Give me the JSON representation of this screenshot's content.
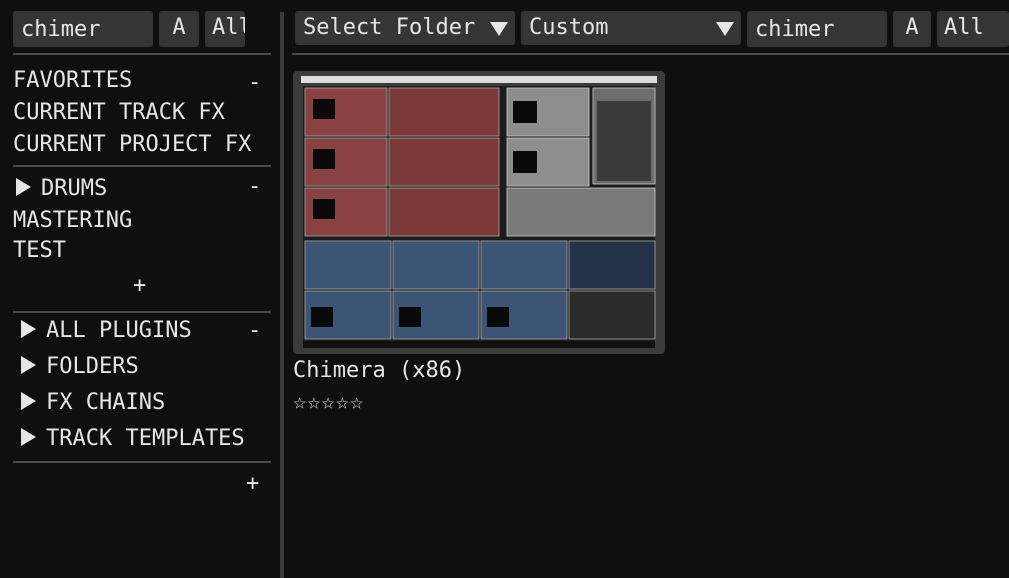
{
  "sidebar": {
    "search_value": "chimer",
    "a_button": "A",
    "all_button": "All",
    "favorites_section": {
      "items": [
        "FAVORITES",
        "CURRENT TRACK FX",
        "CURRENT PROJECT FX"
      ],
      "collapse": "-"
    },
    "custom_section": {
      "items": [
        "DRUMS",
        "MASTERING",
        "TEST"
      ],
      "collapse": "-",
      "add": "+"
    },
    "browse_section": {
      "items": [
        "ALL PLUGINS",
        "FOLDERS",
        "FX CHAINS",
        "TRACK TEMPLATES"
      ],
      "collapse": "-",
      "add": "+"
    }
  },
  "toolbar": {
    "folder_select": "Select Folder",
    "filter_select": "Custom",
    "search_value": "chimer",
    "a_button": "A",
    "all_button": "All"
  },
  "results": [
    {
      "name": "Chimera (x86)",
      "rating_display": "☆☆☆☆☆",
      "rating": 0,
      "thumbnail_icon": "plugin-screenshot-chimera"
    }
  ]
}
